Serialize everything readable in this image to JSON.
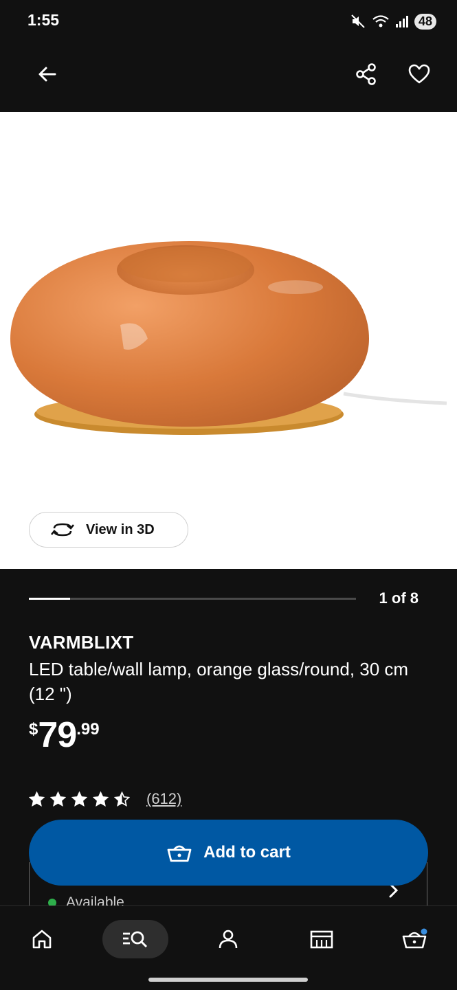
{
  "status_bar": {
    "time": "1:55",
    "battery": "48"
  },
  "app_bar": {
    "back_icon": "arrow-left-icon",
    "share_icon": "share-icon",
    "favorite_icon": "heart-icon"
  },
  "hero": {
    "view3d_label": "View in 3D",
    "view3d_icon": "rotate-3d-icon"
  },
  "gallery": {
    "counter": "1 of 8",
    "current": 1,
    "total": 8
  },
  "product": {
    "name": "VARMBLIXT",
    "description": "LED table/wall lamp, orange glass/round, 30 cm (12 \")",
    "price": {
      "currency": "$",
      "integer": "79",
      "decimal": ".99"
    },
    "rating": {
      "value": 4.5,
      "max": 5,
      "reviews": "(612)"
    }
  },
  "availability": {
    "label": "Available"
  },
  "cart_button": {
    "label": "Add to cart",
    "icon": "basket-icon"
  },
  "bottom_nav": {
    "items": [
      {
        "name": "home",
        "icon": "home-icon",
        "active": false
      },
      {
        "name": "search",
        "icon": "search-icon",
        "active": true
      },
      {
        "name": "profile",
        "icon": "person-icon",
        "active": false
      },
      {
        "name": "store",
        "icon": "store-icon",
        "active": false
      },
      {
        "name": "cart",
        "icon": "basket-icon",
        "active": false,
        "badge": true
      }
    ]
  },
  "colors": {
    "brand_blue": "#0058a3",
    "lamp_orange": "#d9793a",
    "available_green": "#2eae4b"
  }
}
